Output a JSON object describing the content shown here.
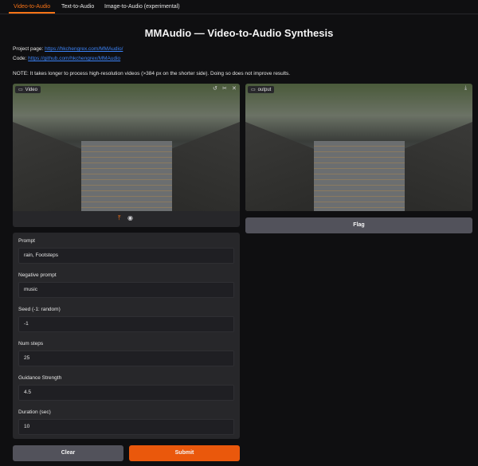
{
  "tabs": [
    {
      "label": "Video-to-Audio"
    },
    {
      "label": "Text-to-Audio"
    },
    {
      "label": "Image-to-Audio (experimental)"
    }
  ],
  "title": "MMAudio — Video-to-Audio Synthesis",
  "project_label": "Project page:",
  "project_url": "https://hkchengrex.com/MMAudio/",
  "code_label": "Code:",
  "code_url": "https://github.com/hkchengrex/MMAudio",
  "note": "NOTE: It takes longer to process high-resolution videos (>384 px on the shorter side). Doing so does not improve results.",
  "video_panel": {
    "label": "Video"
  },
  "output_panel": {
    "label": "output"
  },
  "flag_label": "Flag",
  "fields": [
    {
      "label": "Prompt",
      "value": "rain, Footsteps"
    },
    {
      "label": "Negative prompt",
      "value": "music"
    },
    {
      "label": "Seed (-1: random)",
      "value": "-1"
    },
    {
      "label": "Num steps",
      "value": "25"
    },
    {
      "label": "Guidance Strength",
      "value": "4.5"
    },
    {
      "label": "Duration (sec)",
      "value": "10"
    }
  ],
  "clear_label": "Clear",
  "submit_label": "Submit",
  "colors": {
    "accent": "#f97316",
    "submit": "#ea580c",
    "link": "#3b82f6"
  }
}
